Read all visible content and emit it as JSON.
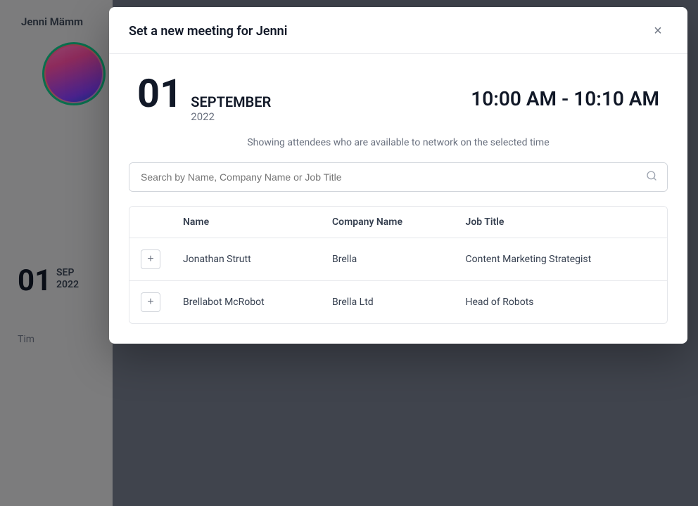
{
  "background": {
    "person_name": "Jenni Mämm",
    "date_large": "01",
    "month_abbr": "SEP",
    "year": "2022",
    "time_label": "Tim"
  },
  "modal": {
    "title": "Set a new meeting for Jenni",
    "close_label": "×",
    "date": {
      "day": "01",
      "month": "SEPTEMBER",
      "year": "2022"
    },
    "time_range": "10:00 AM - 10:10 AM",
    "attendees_info": "Showing attendees who are available to network on the selected time",
    "search": {
      "placeholder": "Search by Name, Company Name or Job Title"
    },
    "table": {
      "columns": [
        {
          "key": "action",
          "label": ""
        },
        {
          "key": "name",
          "label": "Name"
        },
        {
          "key": "company",
          "label": "Company Name"
        },
        {
          "key": "job_title",
          "label": "Job Title"
        }
      ],
      "rows": [
        {
          "add_label": "+",
          "name": "Jonathan Strutt",
          "company": "Brella",
          "job_title": "Content Marketing Strategist"
        },
        {
          "add_label": "+",
          "name": "Brellabot McRobot",
          "company": "Brella Ltd",
          "job_title": "Head of Robots"
        }
      ]
    }
  }
}
